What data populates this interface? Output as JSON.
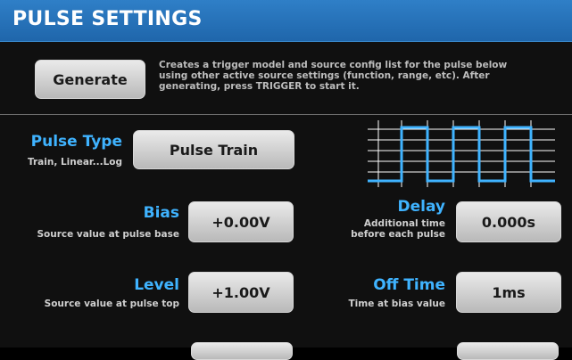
{
  "header": {
    "title": "PULSE SETTINGS"
  },
  "generate": {
    "label": "Generate",
    "description": "Creates a trigger model and source config list for the pulse below using other active source settings (function, range, etc). After generating, press TRIGGER to start it."
  },
  "pulse_type": {
    "label": "Pulse Type",
    "sub": "Train, Linear...Log",
    "value": "Pulse Train"
  },
  "bias": {
    "label": "Bias",
    "sub": "Source value at pulse base",
    "value": "+0.00V"
  },
  "delay": {
    "label": "Delay",
    "sub": "Additional time before each pulse",
    "value": "0.000s"
  },
  "level": {
    "label": "Level",
    "sub": "Source value at pulse top",
    "value": "+1.00V"
  },
  "off_time": {
    "label": "Off Time",
    "sub": "Time at bias value",
    "value": "1ms"
  },
  "colors": {
    "header": "#2473b8",
    "accent": "#3fb3ff",
    "waveform": "#3fb3ff"
  }
}
